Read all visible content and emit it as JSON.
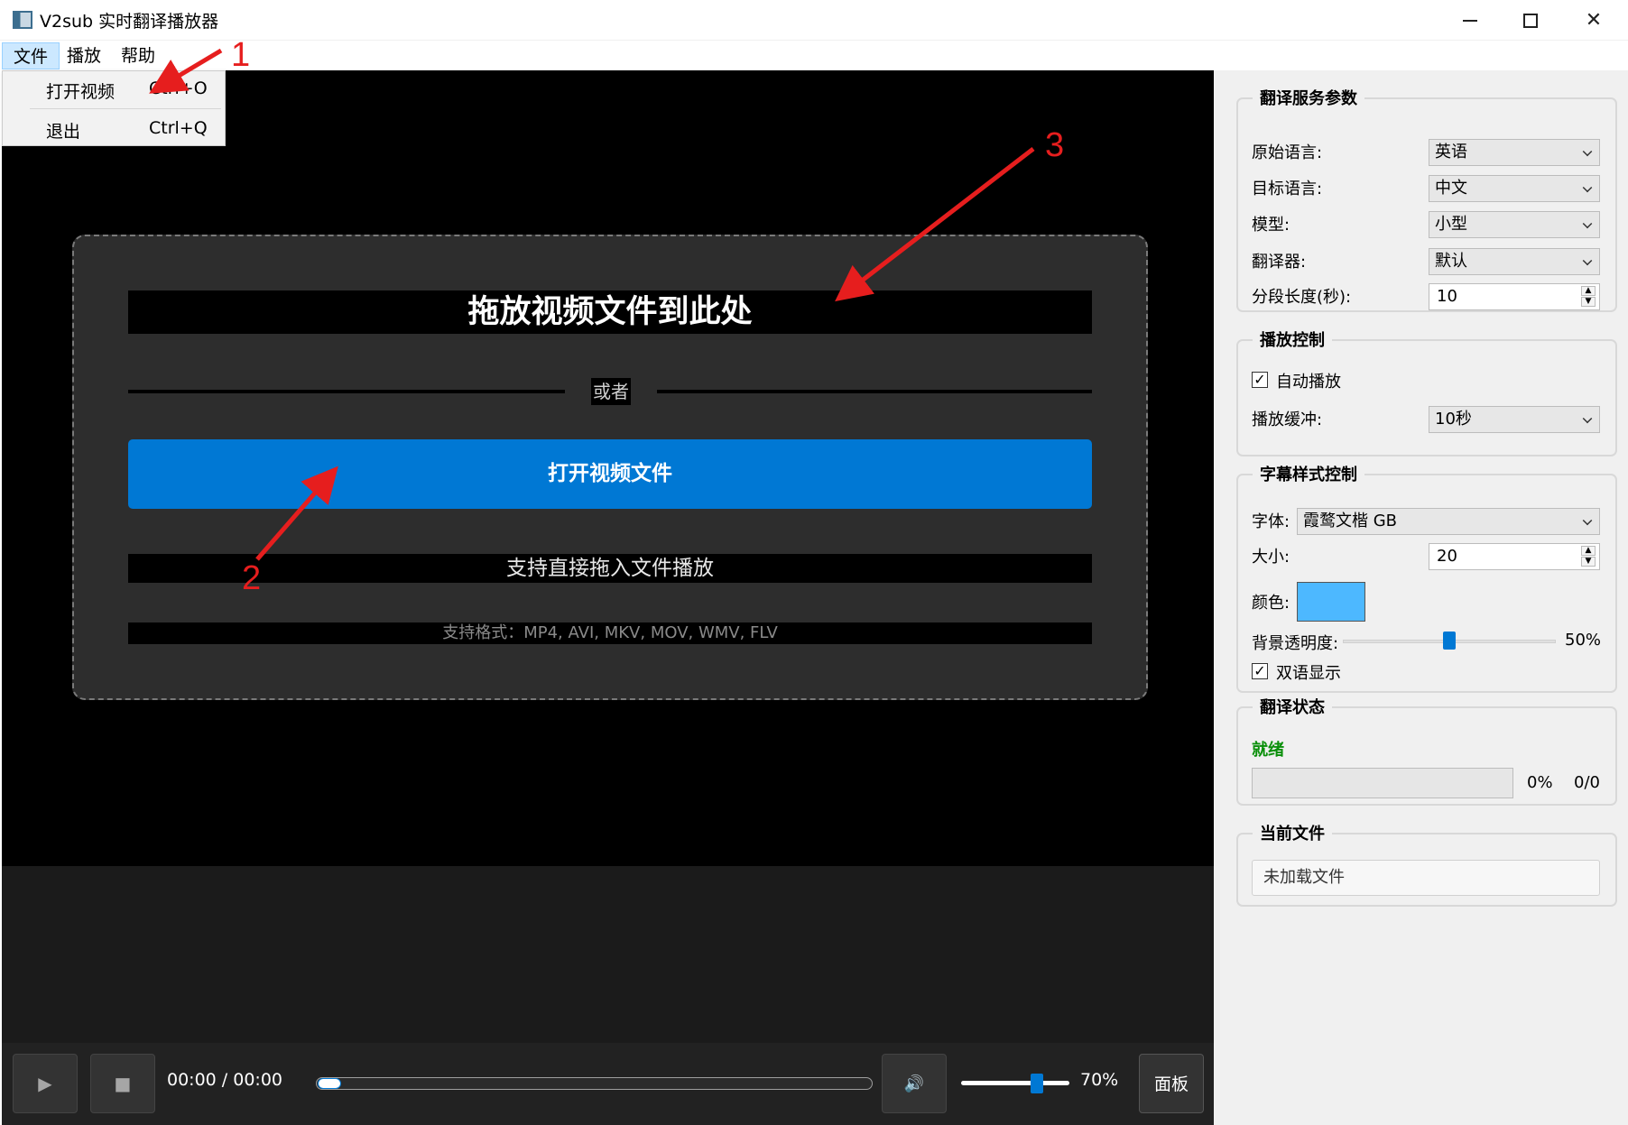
{
  "window": {
    "title": "V2sub 实时翻译播放器",
    "minimize_icon": "minimize-icon",
    "maximize_icon": "maximize-icon",
    "close_glyph": "✕"
  },
  "menubar": {
    "items": [
      {
        "label": "文件",
        "active": true
      },
      {
        "label": "播放",
        "active": false
      },
      {
        "label": "帮助",
        "active": false
      }
    ]
  },
  "file_menu": {
    "items": [
      {
        "label": "打开视频",
        "shortcut": "Ctrl+O"
      },
      {
        "label": "退出",
        "shortcut": "Ctrl+Q"
      }
    ]
  },
  "dropzone": {
    "title": "拖放视频文件到此处",
    "or_text": "或者",
    "open_button": "打开视频文件",
    "hint": "支持直接拖入文件播放",
    "formats": "支持格式：MP4, AVI, MKV, MOV, WMV, FLV"
  },
  "controls": {
    "play_icon": "▶",
    "stop_icon": "■",
    "time": "00:00 / 00:00",
    "progress": 0.0,
    "volume_icon": "🔊",
    "volume": 0.7,
    "volume_label": "70%",
    "panel_button": "面板"
  },
  "translation_params": {
    "title": "翻译服务参数",
    "source_language": {
      "label": "原始语言:",
      "value": "英语"
    },
    "target_language": {
      "label": "目标语言:",
      "value": "中文"
    },
    "model": {
      "label": "模型:",
      "value": "小型"
    },
    "translator": {
      "label": "翻译器:",
      "value": "默认"
    },
    "segment_length": {
      "label": "分段长度(秒):",
      "value": "10"
    }
  },
  "playback": {
    "title": "播放控制",
    "autoplay": {
      "label": "自动播放",
      "checked": true
    },
    "buffer": {
      "label": "播放缓冲:",
      "value": "10秒"
    }
  },
  "subtitle_style": {
    "title": "字幕样式控制",
    "font": {
      "label": "字体:",
      "value": "霞鹜文楷 GB"
    },
    "size": {
      "label": "大小:",
      "value": "20"
    },
    "color": {
      "label": "颜色:",
      "value": "#4db8ff"
    },
    "bg_opacity": {
      "label": "背景透明度:",
      "value": 0.5,
      "display": "50%"
    },
    "bilingual": {
      "label": "双语显示",
      "checked": true
    }
  },
  "status": {
    "title": "翻译状态",
    "state": "就绪",
    "percent": "0%",
    "count": "0/0"
  },
  "current_file": {
    "title": "当前文件",
    "value": "未加载文件"
  },
  "annotations": {
    "labels": [
      "1",
      "2",
      "3"
    ],
    "color": "#e61e1e"
  },
  "colors": {
    "accent": "#0078d4",
    "video_bg": "#000000",
    "dropzone_bg": "#2d2d2d",
    "panel_bg": "#f0f0f0",
    "ready_green": "#0a8f0a"
  }
}
